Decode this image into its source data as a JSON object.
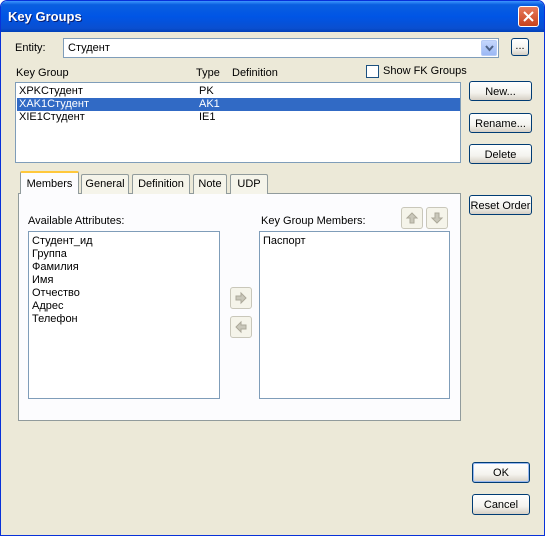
{
  "window": {
    "title": "Key Groups"
  },
  "entity": {
    "label": "Entity:",
    "value": "Студент",
    "browse_label": "..."
  },
  "key_list": {
    "headers": [
      "Key Group",
      "Type",
      "Definition"
    ],
    "show_fk_label": "Show FK Groups",
    "rows": [
      {
        "name": "XPKСтудент",
        "type": "PK",
        "definition": "",
        "selected": false
      },
      {
        "name": "XAK1Студент",
        "type": "AK1",
        "definition": "",
        "selected": true
      },
      {
        "name": "XIE1Студент",
        "type": "IE1",
        "definition": "",
        "selected": false
      }
    ]
  },
  "buttons": {
    "new": "New...",
    "rename": "Rename...",
    "delete": "Delete",
    "reset_order": "Reset Order",
    "ok": "OK",
    "cancel": "Cancel"
  },
  "tabs": [
    "Members",
    "General",
    "Definition",
    "Note",
    "UDP"
  ],
  "members": {
    "available_label": "Available Attributes:",
    "available": [
      "Студент_ид",
      "Группа",
      "Фамилия",
      "Имя",
      "Отчество",
      "Адрес",
      "Телефон"
    ],
    "members_label": "Key Group Members:",
    "members": [
      "Паспорт"
    ]
  },
  "colors": {
    "selection": "#316AC5",
    "title_bar": "#0055E5",
    "dialog_bg": "#ECE9D8"
  }
}
